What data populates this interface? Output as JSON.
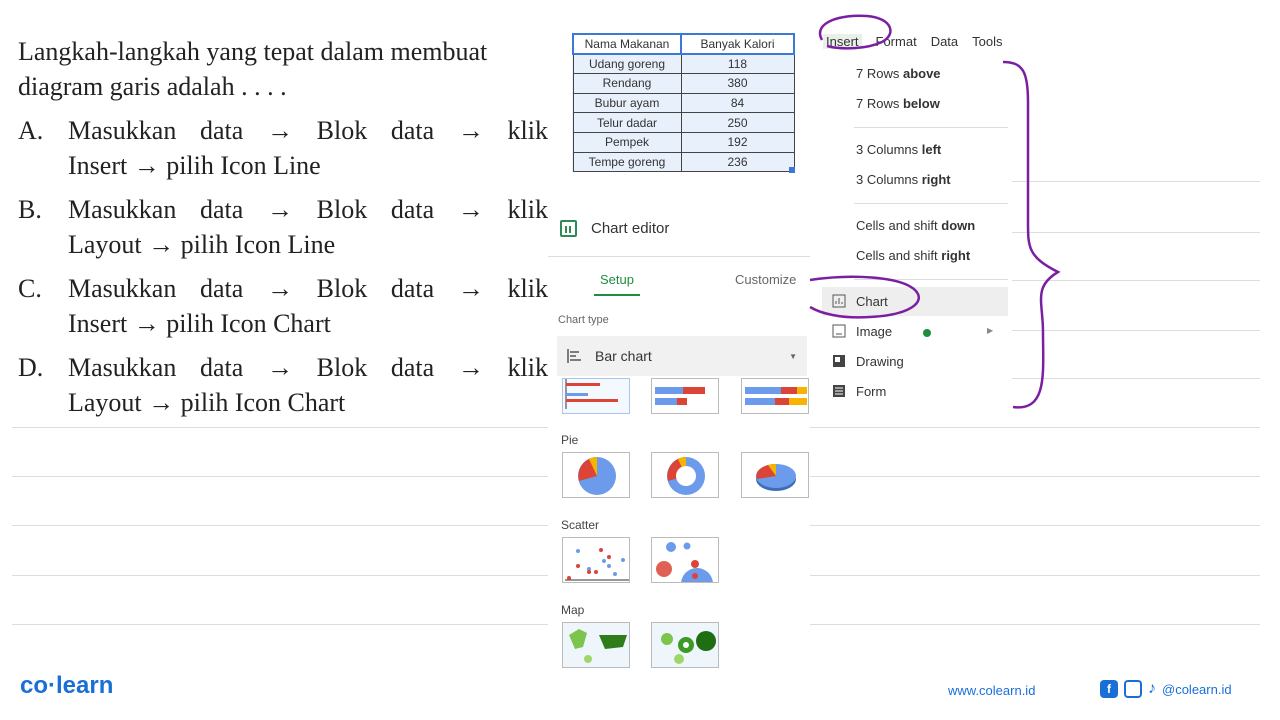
{
  "question": {
    "stem_line1": "Langkah-langkah yang tepat dalam membuat",
    "stem_line2": "diagram garis adalah . . . .",
    "options": [
      {
        "letter": "A.",
        "line1": "Masukkan data → Blok data → klik",
        "line2": "Insert → pilih Icon Line"
      },
      {
        "letter": "B.",
        "line1": "Masukkan data → Blok data → klik",
        "line2": "Layout → pilih Icon Line"
      },
      {
        "letter": "C.",
        "line1": "Masukkan data → Blok data → klik",
        "line2": "Insert → pilih Icon Chart"
      },
      {
        "letter": "D.",
        "line1": "Masukkan data → Blok data → klik",
        "line2": "Layout → pilih Icon Chart"
      }
    ]
  },
  "sheet": {
    "headers": [
      "Nama Makanan",
      "Banyak Kalori"
    ],
    "rows": [
      [
        "Udang goreng",
        "118"
      ],
      [
        "Rendang",
        "380"
      ],
      [
        "Bubur ayam",
        "84"
      ],
      [
        "Telur dadar",
        "250"
      ],
      [
        "Pempek",
        "192"
      ],
      [
        "Tempe goreng",
        "236"
      ]
    ]
  },
  "chart_editor": {
    "title": "Chart editor",
    "tabs": [
      "Setup",
      "Customize"
    ],
    "chart_type_label": "Chart type",
    "chart_type_value": "Bar chart",
    "sections": [
      "Pie",
      "Scatter",
      "Map"
    ]
  },
  "menu_bar": [
    "Insert",
    "Format",
    "Data",
    "Tools"
  ],
  "insert_menu": {
    "rows_above": [
      "7 Rows ",
      "above"
    ],
    "rows_below": [
      "7 Rows ",
      "below"
    ],
    "cols_left": [
      "3 Columns ",
      "left"
    ],
    "cols_right": [
      "3 Columns ",
      "right"
    ],
    "shift_down": [
      "Cells and shift ",
      "down"
    ],
    "shift_right": [
      "Cells and shift ",
      "right"
    ],
    "chart": "Chart",
    "image": "Image",
    "drawing": "Drawing",
    "form": "Form"
  },
  "footer": {
    "logo": "co·learn",
    "url": "www.colearn.id",
    "handle": "@colearn.id"
  },
  "colors": {
    "brand": "#1a6fd6",
    "annotation": "#7b1fa2",
    "accent_green": "#1e8e3e"
  }
}
